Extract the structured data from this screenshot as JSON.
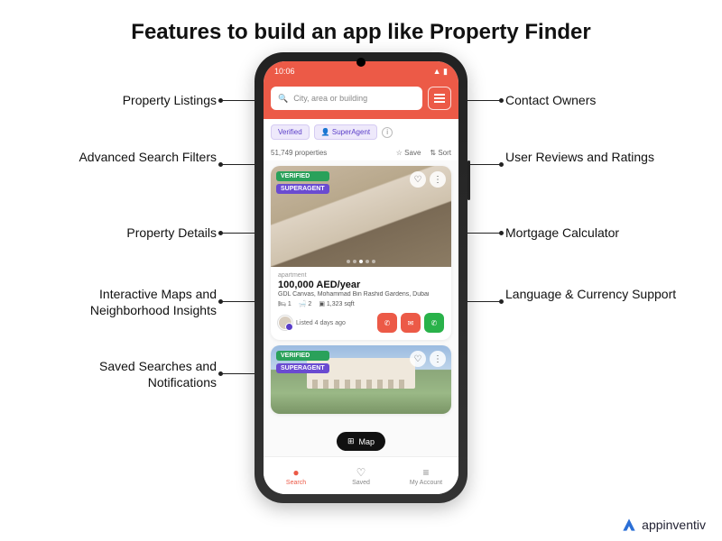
{
  "title": "Features to build an app like Property Finder",
  "features_left": [
    "Property Listings",
    "Advanced Search Filters",
    "Property Details",
    "Interactive Maps and Neighborhood Insights",
    "Saved Searches and Notifications"
  ],
  "features_right": [
    "Contact Owners",
    "User Reviews and Ratings",
    "Mortgage Calculator",
    "Language & Currency Support"
  ],
  "phone": {
    "status_time": "10:06",
    "search_placeholder": "City, area or building",
    "chips": {
      "verified": "Verified",
      "superagent": "SuperAgent"
    },
    "results_count": "51,749 properties",
    "actions": {
      "save": "Save",
      "sort": "Sort"
    },
    "listing1": {
      "tag_verified": "VERIFIED",
      "tag_super": "SUPERAGENT",
      "agent": "apartment",
      "price": "100,000 AED/year",
      "address": "GDL Canvas, Mohammad Bin Rashid Gardens, Dubai",
      "beds": "1",
      "baths": "2",
      "area": "1,323 sqft",
      "posted": "Listed 4 days ago"
    },
    "listing2": {
      "tag_verified": "VERIFIED",
      "tag_super": "SUPERAGENT"
    },
    "map_label": "Map",
    "bottom": {
      "search": "Search",
      "saved": "Saved",
      "account": "My Account"
    }
  },
  "brand": "appinventiv"
}
